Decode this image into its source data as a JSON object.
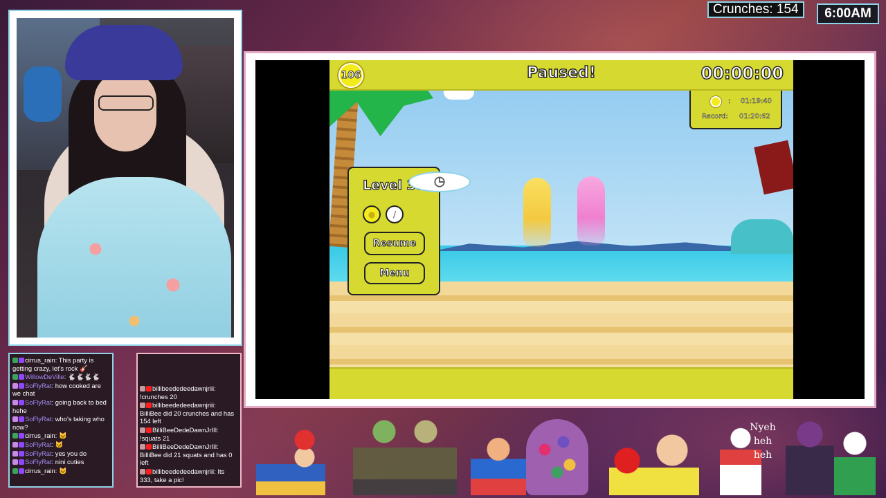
{
  "overlay": {
    "crunches_text": "Crunches: 154",
    "clock_text": "6:00AM"
  },
  "game": {
    "coin_count": "106",
    "title": "Paused!",
    "timer": "00:00:00",
    "record": {
      "coin_time_label": ":",
      "coin_time": "01:19:40",
      "record_label": "Record:",
      "record_time": "01:20:62"
    },
    "pause_menu": {
      "level_title": "Level 38",
      "resume_label": "Resume",
      "menu_label": "Menu"
    }
  },
  "chat_left": [
    {
      "user": "cirrus_rain",
      "user_style": "white",
      "badges": [
        "mod",
        "twitch"
      ],
      "text": ": This party is getting crazy, let's rock 🎸"
    },
    {
      "user": "WillowDeVille",
      "user_style": "purple",
      "badges": [
        "mod",
        "twitch"
      ],
      "text": ": 🐇🐇🐇🐇"
    },
    {
      "user": "SoFlyRat",
      "user_style": "purple",
      "badges": [
        "sub",
        "twitch"
      ],
      "text": ": how cooked are we chat"
    },
    {
      "user": "SoFlyRat",
      "user_style": "purple",
      "badges": [
        "sub",
        "twitch"
      ],
      "text": ": going back to bed hehe"
    },
    {
      "user": "SoFlyRat",
      "user_style": "purple",
      "badges": [
        "sub",
        "twitch"
      ],
      "text": ": who's taking who now?"
    },
    {
      "user": "cirrus_rain",
      "user_style": "white",
      "badges": [
        "mod",
        "twitch"
      ],
      "text": ": 🐱"
    },
    {
      "user": "SoFlyRat",
      "user_style": "purple",
      "badges": [
        "sub",
        "twitch"
      ],
      "text": ": 🐱"
    },
    {
      "user": "SoFlyRat",
      "user_style": "purple",
      "badges": [
        "sub",
        "twitch"
      ],
      "text": ": yes you do"
    },
    {
      "user": "SoFlyRat",
      "user_style": "purple",
      "badges": [
        "sub",
        "twitch"
      ],
      "text": ": nini cuties"
    },
    {
      "user": "cirrus_rain",
      "user_style": "white",
      "badges": [
        "mod",
        "twitch"
      ],
      "text": ": 🐱"
    }
  ],
  "chat_right": [
    {
      "user": "billibeededeedawnjriii",
      "text": ": !crunches 20"
    },
    {
      "user": "billibeededeedawnjriii",
      "text": ": BilliBee did 20 crunches and has 154 left"
    },
    {
      "user": "BilliBeeDedeDawnJrIII",
      "text": ": !squats 21"
    },
    {
      "user": "BilliBeeDedeDawnJrIII",
      "text": ": BilliBee did 21 squats and has 0 left"
    },
    {
      "user": "billibeededeedawnjriii",
      "text": ": Its 333, take a pic!"
    }
  ],
  "banner": {
    "nyeh_lines": [
      "Nyeh",
      "heh",
      "heh"
    ]
  }
}
